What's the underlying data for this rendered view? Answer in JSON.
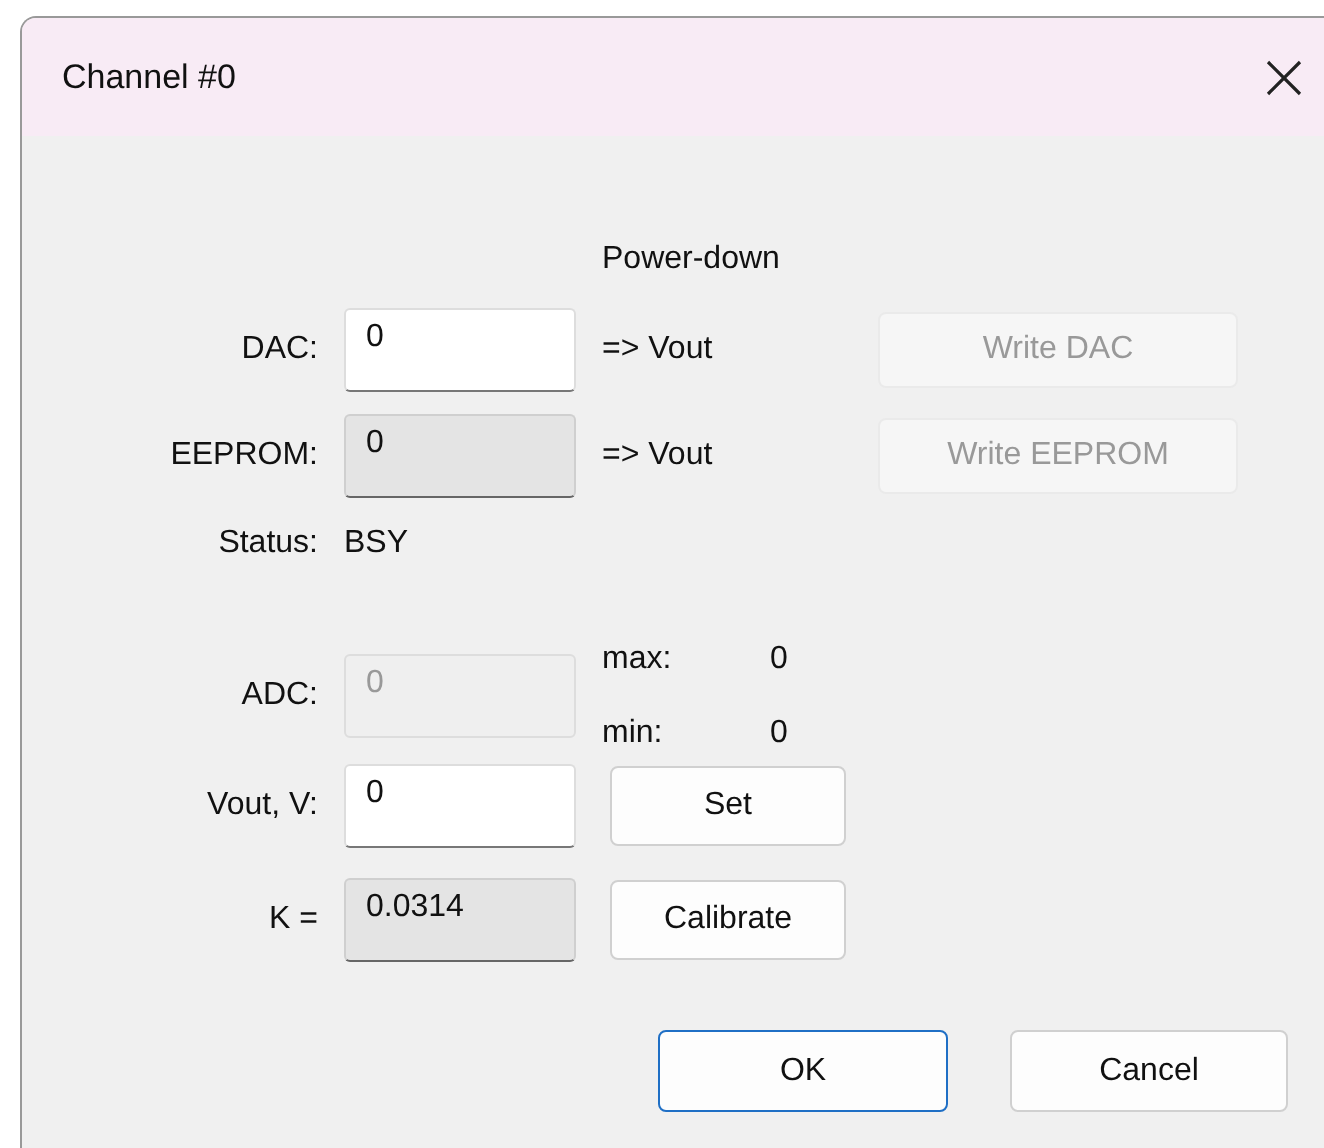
{
  "window": {
    "title": "Channel #0"
  },
  "rows": [
    {
      "kind": "header",
      "text": "Power-down"
    },
    {
      "kind": "field",
      "label": "DAC:",
      "field": {
        "value": "0",
        "readonly": false,
        "disabled": false
      },
      "note": "=> Vout",
      "button": {
        "label": "Write DAC",
        "disabled": true
      }
    },
    {
      "kind": "field",
      "label": "EEPROM:",
      "field": {
        "value": "0",
        "readonly": true,
        "disabled": false
      },
      "note": "=> Vout",
      "button": {
        "label": "Write EEPROM",
        "disabled": true
      }
    },
    {
      "kind": "status",
      "label": "Status:",
      "value": "BSY"
    },
    {
      "kind": "field",
      "label": "ADC:",
      "field": {
        "value": "0",
        "readonly": false,
        "disabled": true
      },
      "readings": [
        {
          "label": "max:",
          "value": "0"
        },
        {
          "label": "min:",
          "value": "0"
        }
      ]
    },
    {
      "kind": "field",
      "label": "Vout, V:",
      "field": {
        "value": "0",
        "readonly": false,
        "disabled": false
      },
      "action": {
        "label": "Set",
        "disabled": false
      }
    },
    {
      "kind": "field",
      "label": "K =",
      "field": {
        "value": "0.0314",
        "readonly": true,
        "disabled": false
      },
      "action": {
        "label": "Calibrate",
        "disabled": false
      }
    }
  ],
  "buttons": [
    {
      "label": "OK",
      "default": true
    },
    {
      "label": "Cancel",
      "default": false
    }
  ]
}
